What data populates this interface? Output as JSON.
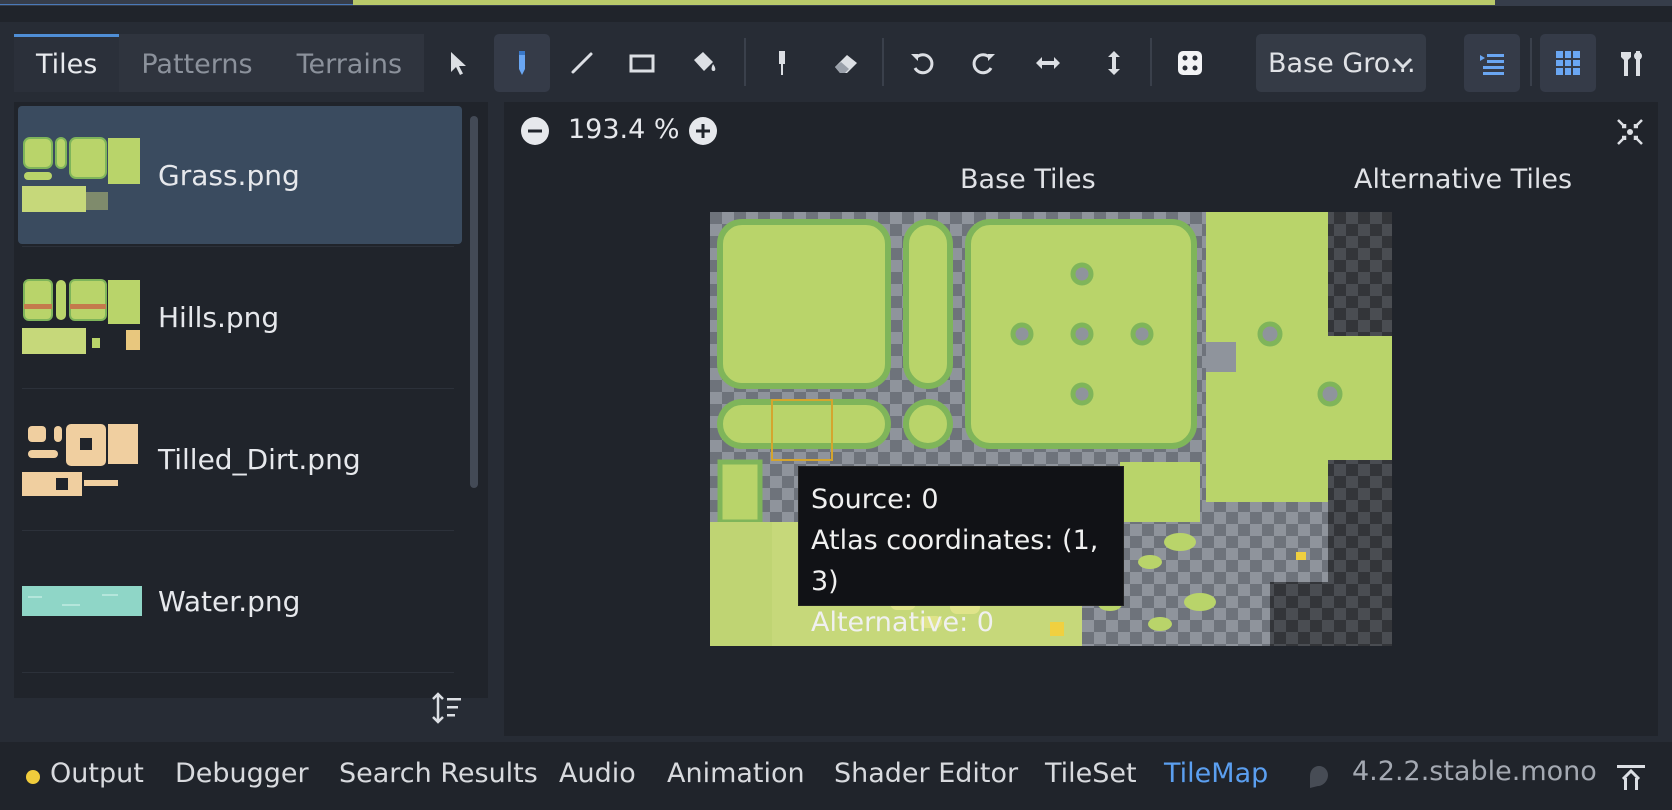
{
  "tabs": [
    {
      "label": "Tiles"
    },
    {
      "label": "Patterns"
    },
    {
      "label": "Terrains"
    }
  ],
  "toolbar": {
    "tools": [
      "select-arrow-icon",
      "pencil-icon",
      "line-icon",
      "rect-icon",
      "bucket-icon",
      "picker-icon",
      "eraser-icon",
      "rotate-left-icon",
      "rotate-right-icon",
      "flip-h-icon",
      "flip-v-icon",
      "dice-icon"
    ],
    "active_tool": "pencil-icon",
    "layer_select": "Base Gro..."
  },
  "sources": [
    {
      "name": "Grass.png",
      "selected": true
    },
    {
      "name": "Hills.png",
      "selected": false
    },
    {
      "name": "Tilled_Dirt.png",
      "selected": false
    },
    {
      "name": "Water.png",
      "selected": false
    }
  ],
  "view": {
    "zoom": "193.4 %",
    "base_tiles_header": "Base Tiles",
    "alt_tiles_header": "Alternative Tiles"
  },
  "tooltip": {
    "source": "Source: 0",
    "atlas": "Atlas coordinates: (1, 3)",
    "alternative": "Alternative: 0"
  },
  "bottom_tabs": [
    {
      "label": "Output"
    },
    {
      "label": "Debugger"
    },
    {
      "label": "Search Results"
    },
    {
      "label": "Audio"
    },
    {
      "label": "Animation"
    },
    {
      "label": "Shader Editor"
    },
    {
      "label": "TileSet"
    },
    {
      "label": "TileMap"
    }
  ],
  "active_bottom_tab": "TileMap",
  "version": "4.2.2.stable.mono",
  "colors": {
    "accent": "#4f8ed6",
    "grass": "#b9d46a",
    "grass_dark": "#7fb55a",
    "dirt": "#f0cfa0",
    "water": "#8fd6c7",
    "output_dot": "#f0cc3c"
  }
}
